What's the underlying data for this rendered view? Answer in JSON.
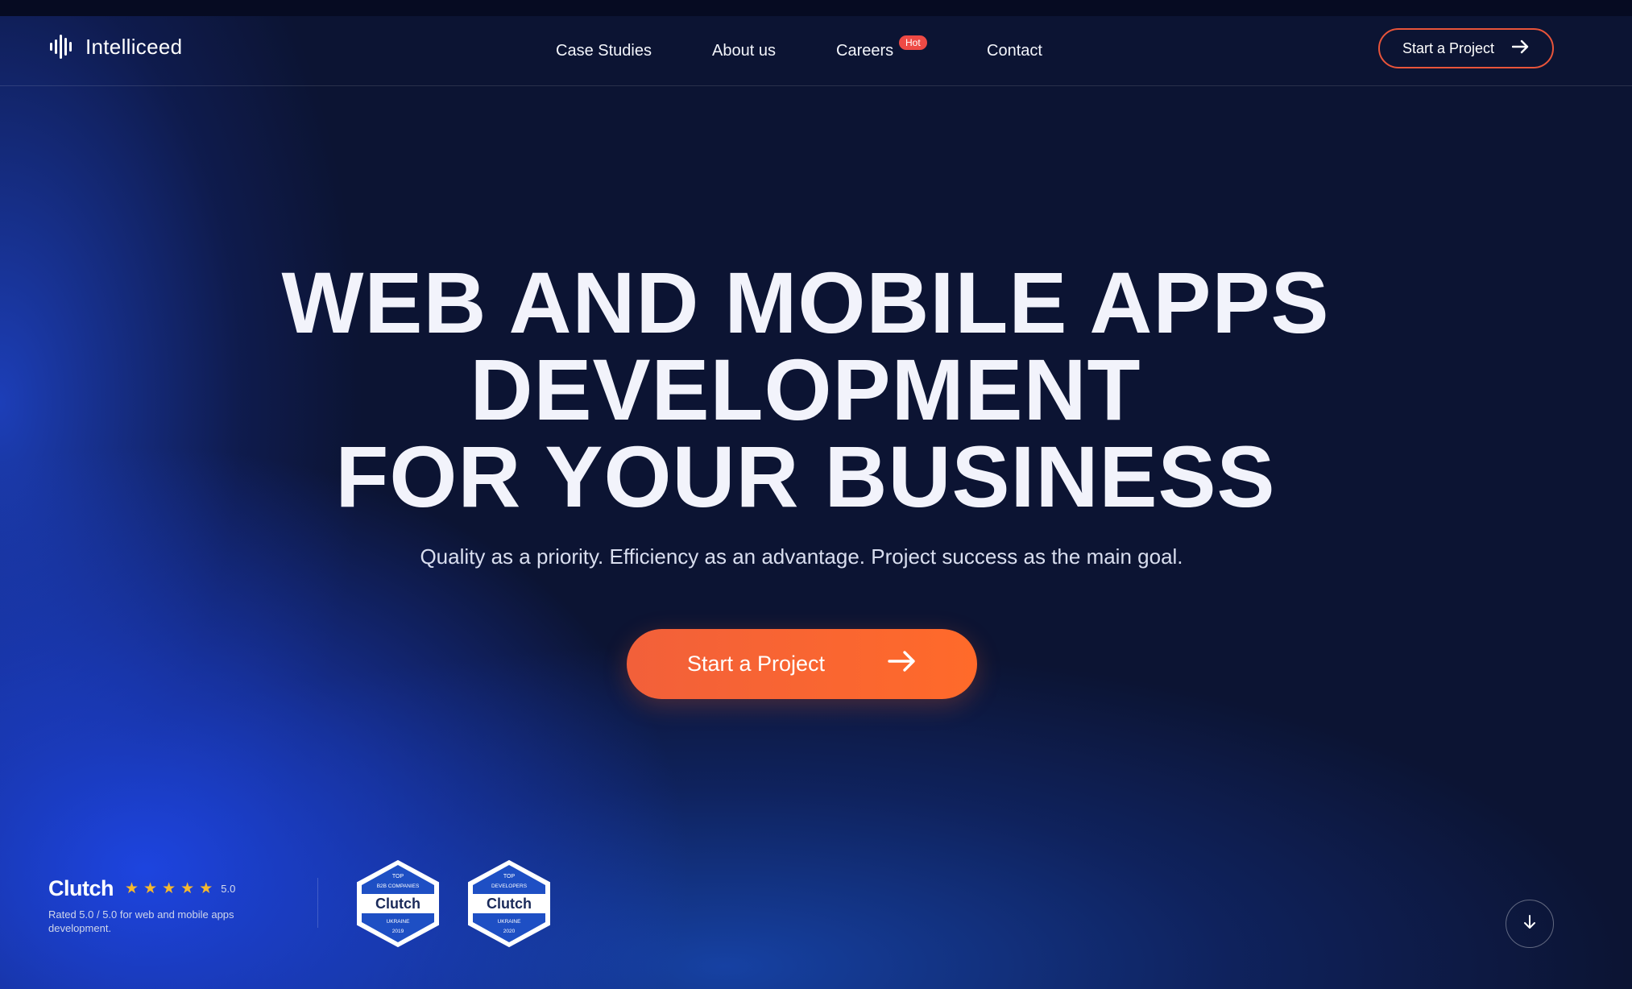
{
  "brand": {
    "name": "Intelliceed",
    "accent_color": "#f2603a",
    "background_color": "#0c1433"
  },
  "nav": {
    "items": [
      {
        "label": "Case Studies"
      },
      {
        "label": "About us"
      },
      {
        "label": "Careers",
        "badge": "Hot"
      },
      {
        "label": "Contact"
      }
    ]
  },
  "header": {
    "cta_label": "Start a Project",
    "cta_icon": "arrow-right-icon"
  },
  "hero": {
    "title_lines": [
      "WEB AND MOBILE APPS",
      "DEVELOPMENT",
      "FOR YOUR BUSINESS"
    ],
    "subtitle": "Quality as a priority. Efficiency as an advantage. Project success as the main goal.",
    "cta_label": "Start a Project",
    "cta_icon": "arrow-right-icon"
  },
  "clutch": {
    "wordmark": "Clutch",
    "stars": 5,
    "rating": "5.0",
    "description": "Rated 5.0 / 5.0 for web and mobile apps development.",
    "badges": [
      {
        "top": "TOP",
        "category": "B2B COMPANIES",
        "brand": "Clutch",
        "country": "UKRAINE",
        "year": "2019"
      },
      {
        "top": "TOP",
        "category": "DEVELOPERS",
        "brand": "Clutch",
        "country": "UKRAINE",
        "year": "2020"
      }
    ]
  },
  "scroll": {
    "icon": "arrow-down-icon"
  }
}
